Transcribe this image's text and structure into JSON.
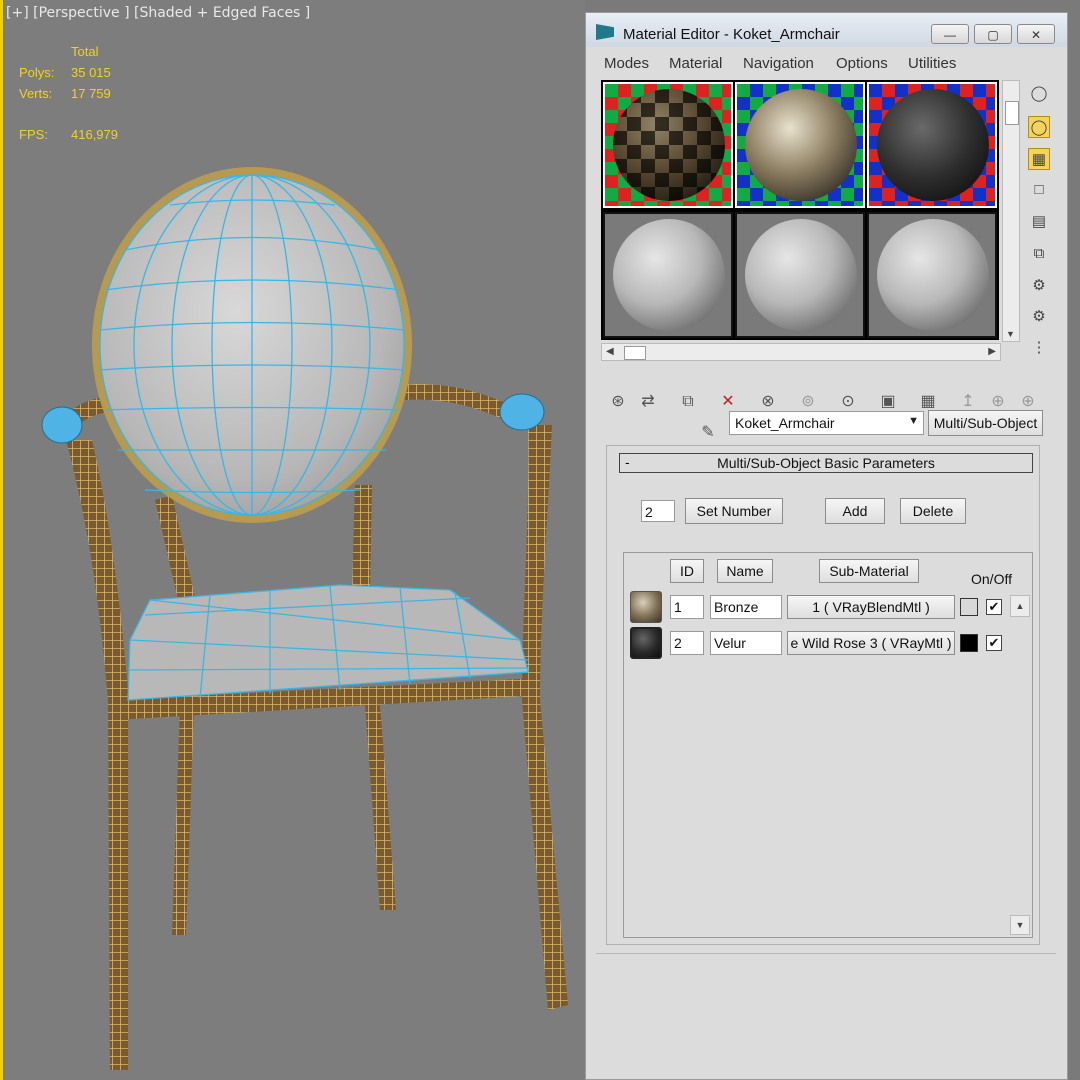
{
  "viewport": {
    "label": "[+] [Perspective ] [Shaded + Edged Faces ]",
    "stats": {
      "total_label": "Total",
      "polys_label": "Polys:",
      "polys_value": "35 015",
      "verts_label": "Verts:",
      "verts_value": "17 759",
      "fps_label": "FPS:",
      "fps_value": "416,979"
    }
  },
  "editor": {
    "title": "Material Editor - Koket_Armchair",
    "window_buttons": {
      "minimize": "—",
      "maximize": "▢",
      "close": "✕"
    },
    "menu": [
      "Modes",
      "Material",
      "Navigation",
      "Options",
      "Utilities"
    ],
    "material_name": "Koket_Armchair",
    "material_type": "Multi/Sub-Object",
    "rollout_title": "Multi/Sub-Object Basic Parameters",
    "rollout_toggle": "-",
    "count_value": "2",
    "set_number_label": "Set Number",
    "add_label": "Add",
    "delete_label": "Delete",
    "headers": {
      "id": "ID",
      "name": "Name",
      "sub_material": "Sub-Material",
      "onoff": "On/Off"
    },
    "rows": [
      {
        "id": "1",
        "name": "Bronze",
        "sub": "1  ( VRayBlendMtl )",
        "swatch": "#d8d8d8",
        "checked": "✔"
      },
      {
        "id": "2",
        "name": "Velur",
        "sub": "e Wild Rose 3  ( VRayMtl )",
        "swatch": "#000000",
        "checked": "✔"
      }
    ],
    "icons": {
      "side": [
        "sphere-shape-icon",
        "backlight-icon",
        "background-checker-icon",
        "sample-uv-icon",
        "video-color-icon",
        "make-preview-icon",
        "options-icon",
        "select-by-material-icon",
        "material-map-navigator-icon"
      ],
      "tools": [
        "get-material-icon",
        "put-to-scene-icon",
        "assign-to-selection-icon",
        "reset-map-icon",
        "make-unique-icon",
        "put-to-library-icon",
        "material-id-channel-icon",
        "show-map-icon",
        "show-end-result-icon",
        "go-to-parent-icon",
        "go-forward-icon",
        "eyedropper-icon"
      ]
    },
    "colors": {
      "accent_active": "#f4d35a",
      "viewport_bg": "#7d7d7d",
      "stat_text": "#f2d21f",
      "wire_blue": "#36b7e8",
      "wire_gold": "#c8a24b"
    }
  }
}
